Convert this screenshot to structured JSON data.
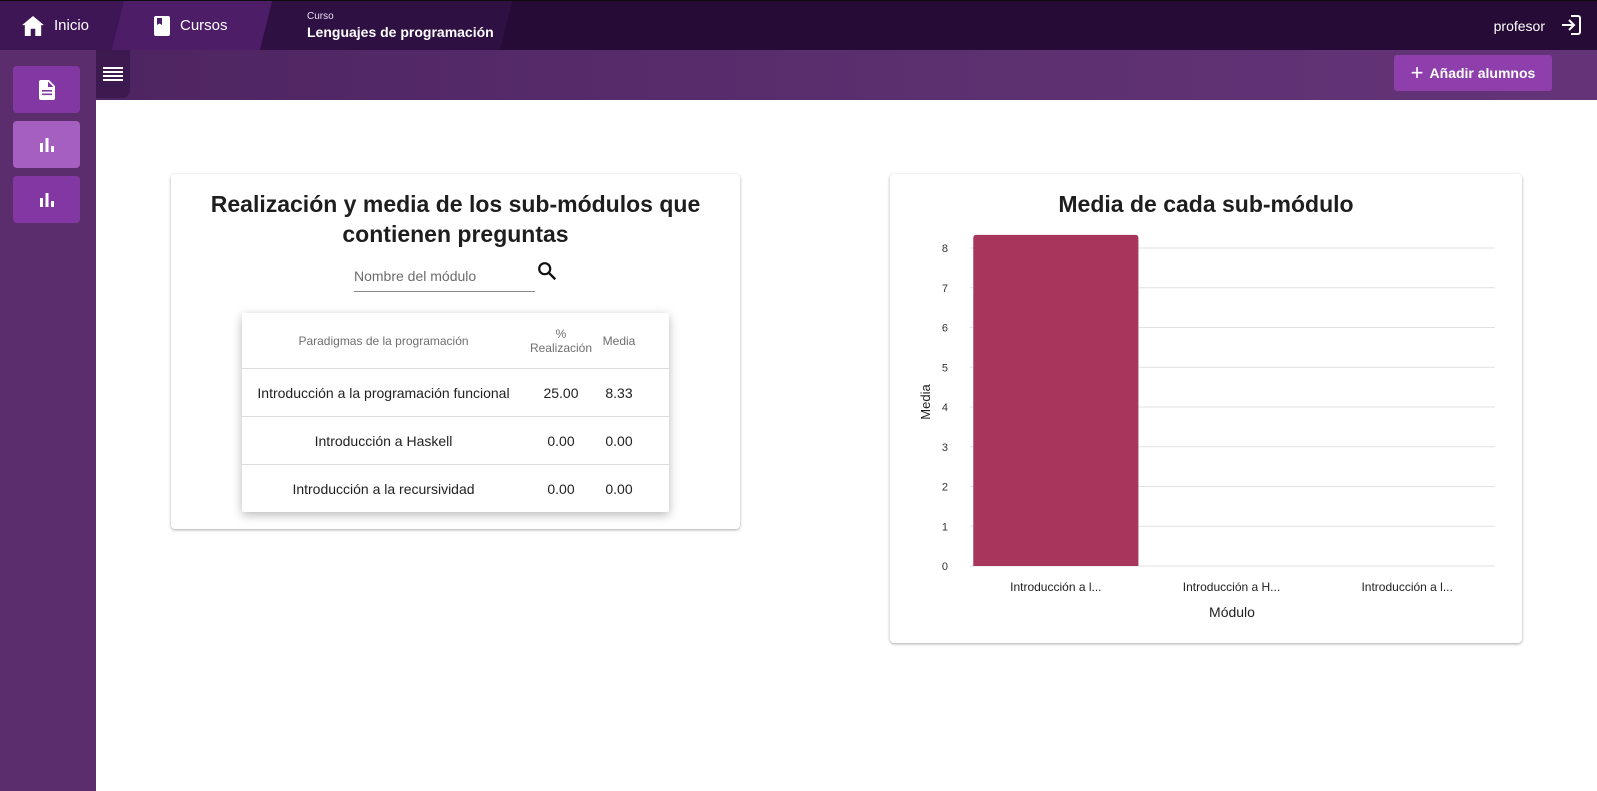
{
  "topbar": {
    "home_label": "Inicio",
    "courses_label": "Cursos",
    "course_small": "Curso",
    "course_name": "Lenguajes de programación",
    "user": "profesor"
  },
  "actions": {
    "add_students_label": "Añadir alumnos"
  },
  "table_card": {
    "title": "Realización y media de los sub-módulos que contienen preguntas",
    "search_placeholder": "Nombre del módulo",
    "columns": [
      "Paradigmas de la programación",
      "% Realización",
      "Media"
    ],
    "rows": [
      {
        "name": "Introducción a la programación funcional",
        "pct": "25.00",
        "media": "8.33"
      },
      {
        "name": "Introducción a Haskell",
        "pct": "0.00",
        "media": "0.00"
      },
      {
        "name": "Introducción a la recursividad",
        "pct": "0.00",
        "media": "0.00"
      }
    ]
  },
  "chart_card": {
    "title": "Media de cada sub-módulo"
  },
  "chart_data": {
    "type": "bar",
    "categories": [
      "Introducción a l...",
      "Introducción a H...",
      "Introducción a l..."
    ],
    "values": [
      8.33,
      0,
      0
    ],
    "xlabel": "Módulo",
    "ylabel": "Media",
    "ylim": [
      0,
      8
    ],
    "yticks": [
      "0",
      "1",
      "2",
      "3",
      "4",
      "5",
      "6",
      "7",
      "8"
    ],
    "bar_color": "#a8365c",
    "grid": true
  },
  "colors": {
    "accent": "#8e3fab",
    "topbar": "#250b36",
    "sidebar": "#5c2d6d"
  }
}
